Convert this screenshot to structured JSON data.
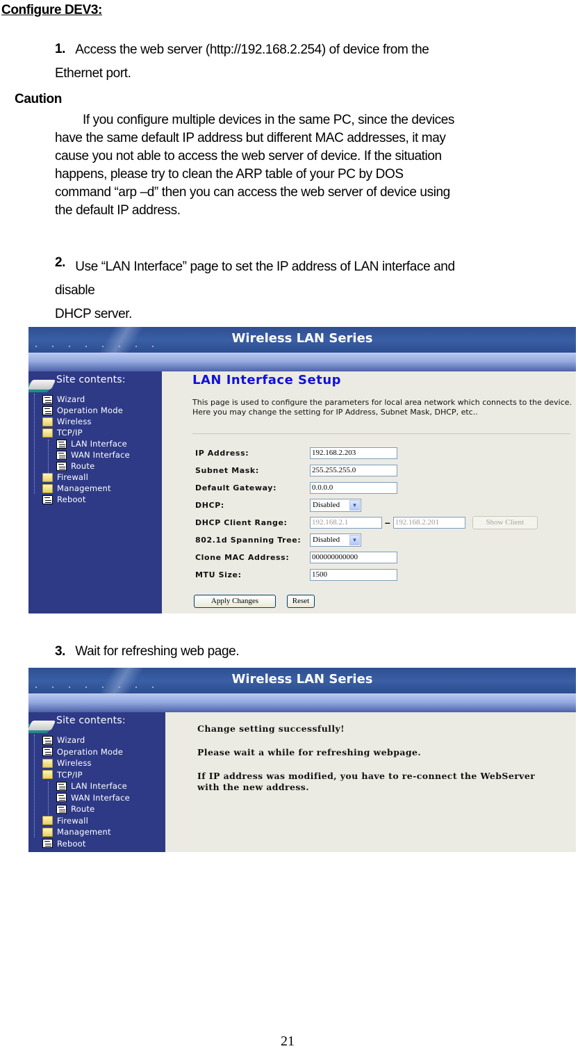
{
  "document": {
    "heading": "Configure DEV3:",
    "step1": {
      "number": "1.",
      "line1": "Access the web server (http://192.168.2.254) of device from the",
      "line2": "Ethernet port."
    },
    "caution": {
      "label": "Caution",
      "lines": [
        "If you configure multiple devices in the same PC, since the devices",
        "have the same default IP address but different MAC addresses, it may",
        "cause you not able to access the web server of device. If the situation",
        "happens, please try to clean the ARP table of your PC by DOS",
        "command “arp –d” then you can access the web server of device using",
        "the default IP address."
      ]
    },
    "step2": {
      "number": "2.",
      "line1": "Use “LAN Interface” page to set the IP address of LAN interface and",
      "line2": "disable",
      "line3": "DHCP server."
    },
    "step3": {
      "number": "3.",
      "line1": "Wait for refreshing web page."
    },
    "page_number": "21"
  },
  "router_ui": {
    "banner_title": "Wireless LAN Series",
    "site_contents_label": "Site contents:",
    "tree": [
      {
        "label": "Wizard",
        "icon": "page-icon",
        "level": 0
      },
      {
        "label": "Operation Mode",
        "icon": "page-icon",
        "level": 0
      },
      {
        "label": "Wireless",
        "icon": "folder-icon",
        "level": 0
      },
      {
        "label": "TCP/IP",
        "icon": "folder-open-icon",
        "level": 0
      },
      {
        "label": "LAN Interface",
        "icon": "page-icon",
        "level": 1
      },
      {
        "label": "WAN Interface",
        "icon": "page-icon",
        "level": 1
      },
      {
        "label": "Route",
        "icon": "page-icon",
        "level": 1
      },
      {
        "label": "Firewall",
        "icon": "folder-icon",
        "level": 0
      },
      {
        "label": "Management",
        "icon": "folder-icon",
        "level": 0
      },
      {
        "label": "Reboot",
        "icon": "page-icon",
        "level": 0
      }
    ],
    "lan_setup": {
      "title": "LAN Interface Setup",
      "description": "This page is used to configure the parameters for local area network which connects to the device. Here you may change the setting for IP Address, Subnet Mask, DHCP, etc..",
      "fields": {
        "ip_address": {
          "label": "IP Address:",
          "value": "192.168.2.203"
        },
        "subnet_mask": {
          "label": "Subnet Mask:",
          "value": "255.255.255.0"
        },
        "default_gateway": {
          "label": "Default Gateway:",
          "value": "0.0.0.0"
        },
        "dhcp": {
          "label": "DHCP:",
          "value": "Disabled"
        },
        "dhcp_client_range": {
          "label": "DHCP Client Range:",
          "start": "192.168.2.1",
          "separator": "–",
          "end": "192.168.2.201",
          "show_client_label": "Show Client"
        },
        "spanning_tree": {
          "label": "802.1d Spanning Tree:",
          "value": "Disabled"
        },
        "clone_mac": {
          "label": "Clone MAC Address:",
          "value": "000000000000"
        },
        "mtu_size": {
          "label": "MTU Size:",
          "value": "1500"
        }
      },
      "apply_label": "Apply Changes",
      "reset_label": "Reset"
    },
    "refresh_page": {
      "line1": "Change setting successfully!",
      "line2": "Please wait a while for refreshing webpage.",
      "line3": "If IP address was modified, you have to re-connect the WebServer",
      "line4": "with the new address."
    }
  }
}
